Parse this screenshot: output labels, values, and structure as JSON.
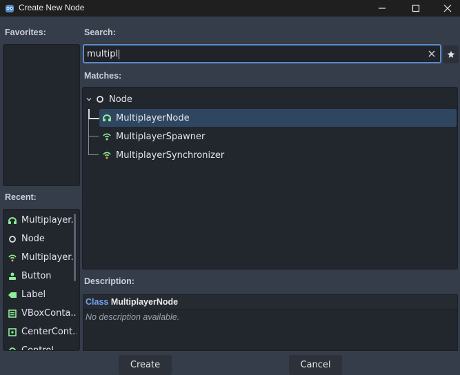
{
  "window": {
    "title": "Create New Node",
    "app_icon": "godot-icon",
    "controls": [
      "minimize-icon",
      "maximize-icon",
      "close-icon"
    ]
  },
  "labels": {
    "favorites": "Favorites:",
    "search": "Search:",
    "matches": "Matches:",
    "recent": "Recent:",
    "description": "Description:"
  },
  "search": {
    "value": "multipl",
    "clear_icon": "close-icon",
    "favorite_icon": "star-icon"
  },
  "matches": {
    "root": {
      "label": "Node",
      "icon": "node-circle-icon",
      "expand_icon": "chevron-down-icon"
    },
    "children": [
      {
        "label": "MultiplayerNode",
        "icon": "multiplayer-node-icon",
        "selected": true
      },
      {
        "label": "MultiplayerSpawner",
        "icon": "multiplayer-spawner-icon",
        "selected": false
      },
      {
        "label": "MultiplayerSynchronizer",
        "icon": "multiplayer-synchronizer-icon",
        "selected": false
      }
    ]
  },
  "recent": [
    {
      "label": "Multiplayer...",
      "icon": "multiplayer-node-icon"
    },
    {
      "label": "Node",
      "icon": "node-circle-icon"
    },
    {
      "label": "Multiplayer...",
      "icon": "multiplayer-spawner-icon"
    },
    {
      "label": "Button",
      "icon": "button-icon"
    },
    {
      "label": "Label",
      "icon": "label-icon"
    },
    {
      "label": "VBoxConta...",
      "icon": "vbox-container-icon"
    },
    {
      "label": "CenterCont...",
      "icon": "center-container-icon"
    },
    {
      "label": "Control",
      "icon": "control-icon"
    }
  ],
  "description": {
    "class_keyword": "Class",
    "class_name": "MultiplayerNode",
    "text": "No description available."
  },
  "buttons": {
    "create": "Create",
    "cancel": "Cancel"
  },
  "colors": {
    "accent": "#5b8cc9",
    "selection": "#2f4660",
    "class_keyword": "#6fa2f0",
    "node_green": "#8eef97",
    "node_white": "#e2e5ea"
  }
}
